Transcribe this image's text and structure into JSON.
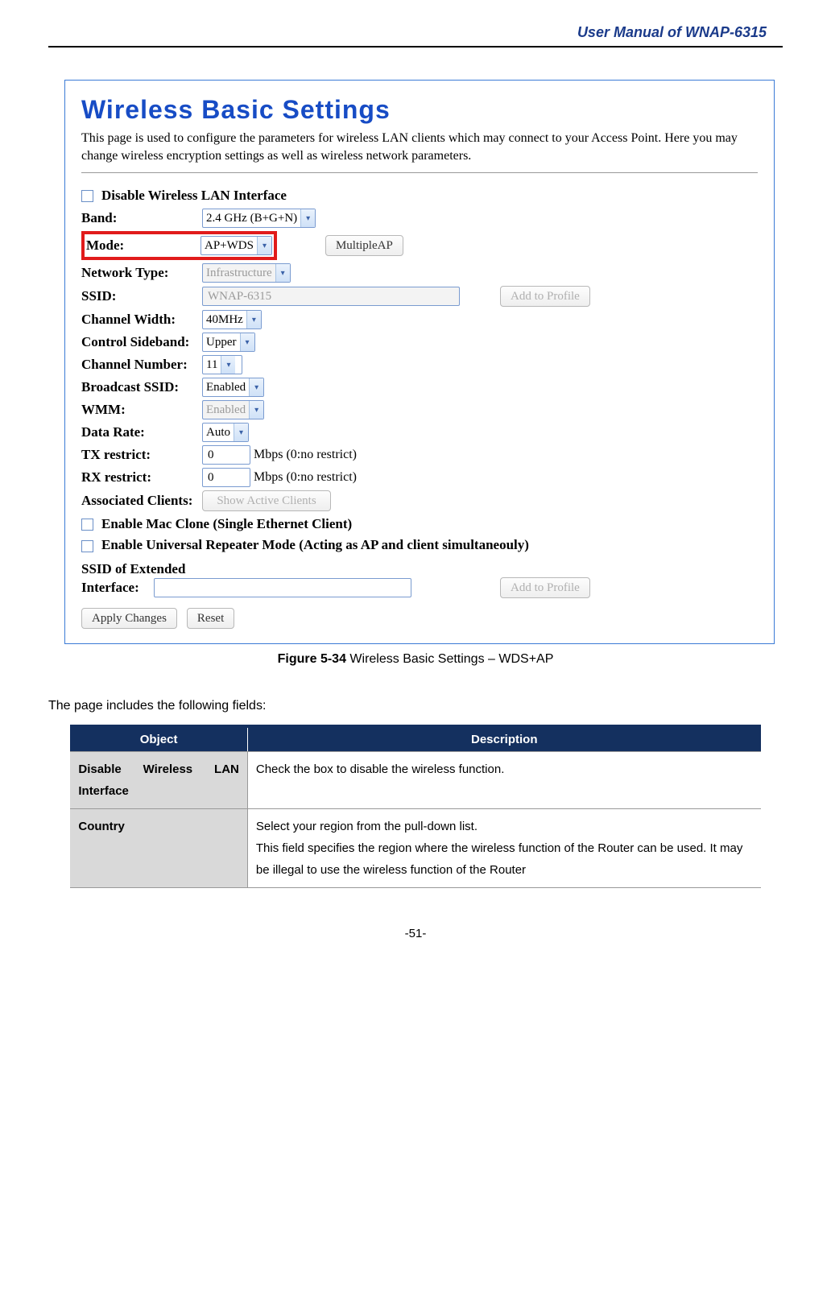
{
  "header": {
    "title": "User Manual of WNAP-6315"
  },
  "screenshot": {
    "title": "Wireless Basic Settings",
    "desc": "This page is used to configure the parameters for wireless LAN clients which may connect to your Access Point. Here you may change wireless encryption settings as well as wireless network parameters.",
    "disable_wlan_label": "Disable Wireless LAN Interface",
    "fields": {
      "band_label": "Band:",
      "band_value": "2.4 GHz (B+G+N)",
      "mode_label": "Mode:",
      "mode_value": "AP+WDS",
      "multiple_ap_btn": "MultipleAP",
      "network_type_label": "Network Type:",
      "network_type_value": "Infrastructure",
      "ssid_label": "SSID:",
      "ssid_value": "WNAP-6315",
      "add_to_profile_btn": "Add to Profile",
      "channel_width_label": "Channel Width:",
      "channel_width_value": "40MHz",
      "control_sideband_label": "Control Sideband:",
      "control_sideband_value": "Upper",
      "channel_number_label": "Channel Number:",
      "channel_number_value": "11",
      "broadcast_ssid_label": "Broadcast SSID:",
      "broadcast_ssid_value": "Enabled",
      "wmm_label": "WMM:",
      "wmm_value": "Enabled",
      "data_rate_label": "Data Rate:",
      "data_rate_value": "Auto",
      "tx_restrict_label": "TX restrict:",
      "tx_restrict_value": "0",
      "tx_restrict_unit": "Mbps (0:no restrict)",
      "rx_restrict_label": "RX restrict:",
      "rx_restrict_value": "0",
      "rx_restrict_unit": "Mbps (0:no restrict)",
      "associated_clients_label": "Associated Clients:",
      "show_active_clients_btn": "Show Active Clients",
      "enable_mac_clone_label": "Enable Mac Clone (Single Ethernet Client)",
      "enable_universal_repeater_label": "Enable Universal Repeater Mode (Acting as AP and client simultaneouly)",
      "ssid_ext_label": "SSID of Extended Interface:",
      "apply_btn": "Apply Changes",
      "reset_btn": "Reset"
    }
  },
  "figure_caption_bold": "Figure 5-34",
  "figure_caption_rest": " Wireless Basic Settings – WDS+AP",
  "intro_text": "The page includes the following fields:",
  "table": {
    "head_object": "Object",
    "head_description": "Description",
    "rows": [
      {
        "object": "Disable Wireless LAN Interface",
        "desc": "Check the box to disable the wireless function."
      },
      {
        "object": "Country",
        "desc": "Select your region from the pull-down list.\nThis field specifies the region where the wireless function of the Router can be used. It may be illegal to use the wireless function of the Router"
      }
    ]
  },
  "footer": "-51-"
}
